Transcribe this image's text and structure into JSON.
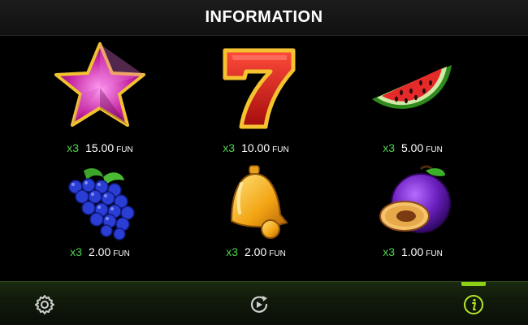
{
  "header": {
    "title": "INFORMATION"
  },
  "symbols": [
    {
      "icon": "star-icon",
      "multiplier": "x3",
      "amount": "15.00",
      "currency": "FUN"
    },
    {
      "icon": "seven-icon",
      "multiplier": "x3",
      "amount": "10.00",
      "currency": "FUN"
    },
    {
      "icon": "watermelon-icon",
      "multiplier": "x3",
      "amount": "5.00",
      "currency": "FUN"
    },
    {
      "icon": "grapes-icon",
      "multiplier": "x3",
      "amount": "2.00",
      "currency": "FUN"
    },
    {
      "icon": "bell-icon",
      "multiplier": "x3",
      "amount": "2.00",
      "currency": "FUN"
    },
    {
      "icon": "plum-icon",
      "multiplier": "x3",
      "amount": "1.00",
      "currency": "FUN"
    }
  ],
  "footer": {
    "buttons": [
      {
        "icon": "gear-icon",
        "active": false
      },
      {
        "icon": "autoplay-icon",
        "active": false
      },
      {
        "icon": "info-icon",
        "active": true
      }
    ],
    "active_color": "#8fd016"
  },
  "colors": {
    "multiplier": "#4fd24f",
    "background": "#000000"
  }
}
